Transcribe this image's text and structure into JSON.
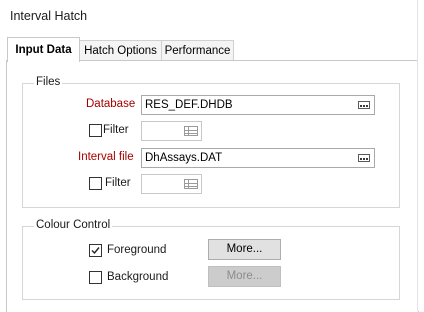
{
  "window": {
    "title": "Interval Hatch"
  },
  "tabs": [
    {
      "label": "Input Data",
      "active": true
    },
    {
      "label": "Hatch Options",
      "active": false
    },
    {
      "label": "Performance",
      "active": false
    }
  ],
  "files": {
    "group_title": "Files",
    "database": {
      "label": "Database",
      "value": "RES_DEF.DHDB"
    },
    "filter1": {
      "label": "Filter",
      "checked": false,
      "value": ""
    },
    "interval_file": {
      "label": "Interval file",
      "value": "DhAssays.DAT"
    },
    "filter2": {
      "label": "Filter",
      "checked": false,
      "value": ""
    }
  },
  "colour_control": {
    "group_title": "Colour Control",
    "foreground": {
      "label": "Foreground",
      "checked": true,
      "button": "More...",
      "button_enabled": true
    },
    "background": {
      "label": "Background",
      "checked": false,
      "button": "More...",
      "button_enabled": false
    }
  },
  "colors": {
    "required_label": "#a50000",
    "disabled_text": "#8c8c8c"
  },
  "icons": [
    "browse-icon",
    "grid-icon",
    "checkmark-icon"
  ]
}
